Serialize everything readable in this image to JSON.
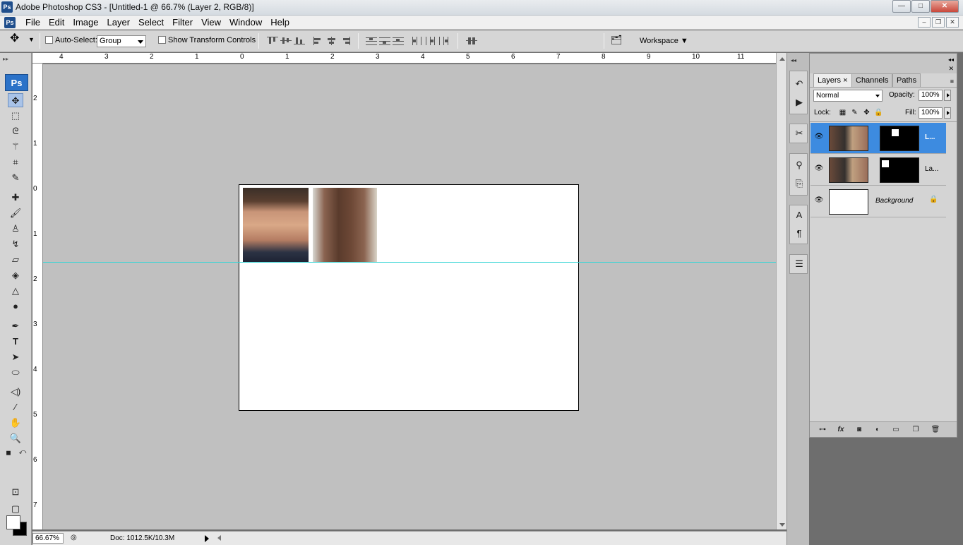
{
  "window": {
    "title": "Adobe Photoshop CS3 - [Untitled-1 @ 66.7% (Layer 2, RGB/8)]",
    "app_badge": "Ps",
    "minimize": "—",
    "maximize": "□",
    "close": "✕"
  },
  "menu": {
    "items": [
      "File",
      "Edit",
      "Image",
      "Layer",
      "Select",
      "Filter",
      "View",
      "Window",
      "Help"
    ],
    "doc_minimize": "–",
    "doc_restore": "❐",
    "doc_close": "✕"
  },
  "options": {
    "auto_select_label": "Auto-Select:",
    "auto_select_value": "Group",
    "show_transform_label": "Show Transform Controls",
    "workspace_label": "Workspace ▼"
  },
  "toolbox": {
    "logo": "Ps",
    "grip": "▸▸"
  },
  "rulers": {
    "top_labels": [
      "4",
      "3",
      "2",
      "1",
      "0",
      "1",
      "2",
      "3",
      "4",
      "5",
      "6",
      "7",
      "8",
      "9",
      "10",
      "11"
    ],
    "left_labels": [
      "2",
      "1",
      "0",
      "1",
      "2",
      "3",
      "4",
      "5",
      "6",
      "7"
    ]
  },
  "status": {
    "zoom": "66.67%",
    "doc": "Doc: 1012.5K/10.3M"
  },
  "layers_panel": {
    "tabs": [
      "Layers ×",
      "Channels",
      "Paths"
    ],
    "blend_mode": "Normal",
    "opacity_label": "Opacity:",
    "opacity_value": "100%",
    "lock_label": "Lock:",
    "fill_label": "Fill:",
    "fill_value": "100%",
    "layers": [
      {
        "name": "L...",
        "visible_icon": "👁"
      },
      {
        "name": "La...",
        "visible_icon": "👁"
      },
      {
        "name": "Background",
        "visible_icon": "👁",
        "lock_icon": "🔒"
      }
    ],
    "footer_icons": [
      "link-icon",
      "fx-icon",
      "mask-icon",
      "adjustment-icon",
      "group-icon",
      "new-layer-icon",
      "trash-icon"
    ]
  },
  "colors": {
    "guide": "#35d5d5",
    "selected_layer": "#3d8be0",
    "canvas_bg": "#c0c0c0"
  }
}
